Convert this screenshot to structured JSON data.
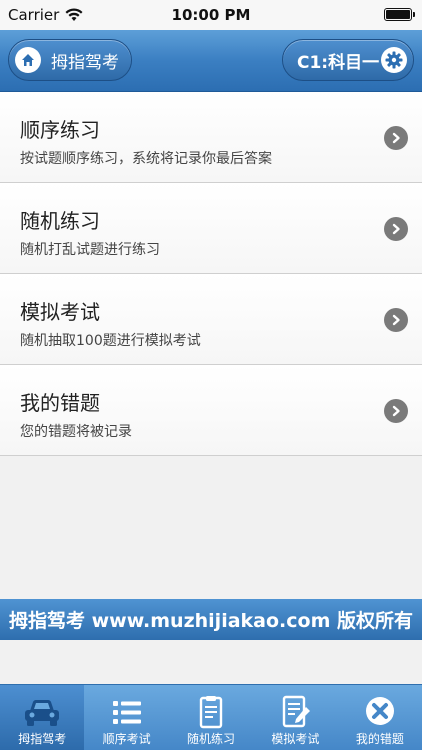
{
  "status_bar": {
    "carrier": "Carrier",
    "time": "10:00 PM"
  },
  "nav": {
    "home_label": "拇指驾考",
    "subject_label": "C1:科目一"
  },
  "menu": {
    "items": [
      {
        "title": "顺序练习",
        "desc": "按试题顺序练习，系统将记录你最后答案"
      },
      {
        "title": "随机练习",
        "desc": "随机打乱试题进行练习"
      },
      {
        "title": "模拟考试",
        "desc": "随机抽取100题进行模拟考试"
      },
      {
        "title": "我的错题",
        "desc": "您的错题将被记录"
      }
    ]
  },
  "banner": {
    "text": "拇指驾考 www.muzhijiakao.com 版权所有"
  },
  "tabs": [
    {
      "label": "拇指驾考",
      "icon": "car-icon"
    },
    {
      "label": "顺序考试",
      "icon": "list-icon"
    },
    {
      "label": "随机练习",
      "icon": "clipboard-icon"
    },
    {
      "label": "模拟考试",
      "icon": "exam-icon"
    },
    {
      "label": "我的错题",
      "icon": "wrong-icon"
    }
  ],
  "colors": {
    "accent": "#3b7fc2",
    "tab_active": "#2d6bab"
  }
}
